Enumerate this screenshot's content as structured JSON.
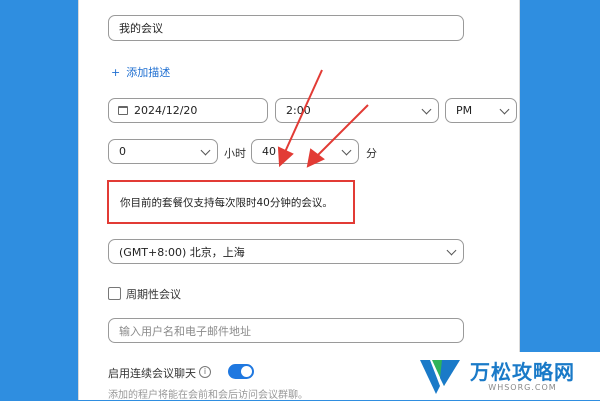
{
  "meeting": {
    "topic": "我的会议",
    "add_description": "添加描述",
    "date": "2024/12/20",
    "time": "2:00",
    "ampm": "PM",
    "duration_hours": "0",
    "hours_unit": "小时",
    "duration_minutes": "40",
    "minutes_unit": "分",
    "notice": "你目前的套餐仅支持每次限时40分钟的会议。",
    "timezone": "(GMT+8:00) 北京，上海",
    "recurring_label": "周期性会议",
    "invite_placeholder": "输入用户名和电子邮件地址",
    "chat_label": "启用连续会议聊天",
    "chat_hint": "添加的程户将能在会前和会后访问会议群聊。"
  },
  "watermark": {
    "title": "万松攻略网",
    "sub": "WHSORG.COM"
  },
  "colors": {
    "background": "#2f8ee0",
    "accent": "#1f78e0",
    "highlight": "#e23b35"
  }
}
